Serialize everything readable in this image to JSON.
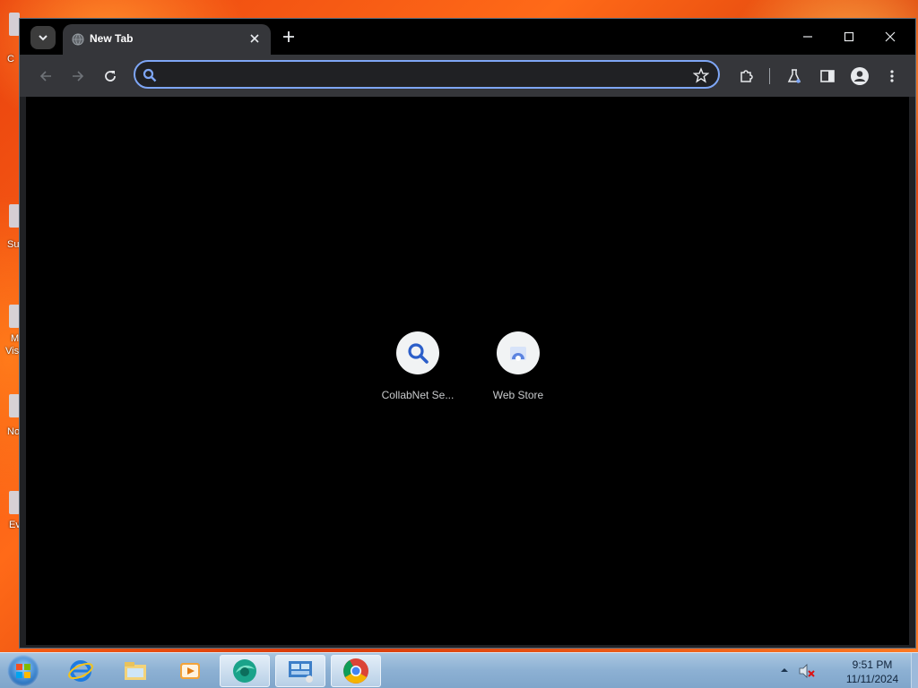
{
  "browser": {
    "tab": {
      "title": "New Tab"
    },
    "omnibox": {
      "value": "",
      "placeholder": ""
    },
    "shortcuts": [
      {
        "label": "CollabNet Se...",
        "icon": "search-icon"
      },
      {
        "label": "Web Store",
        "icon": "web-store-icon"
      }
    ],
    "colors": {
      "accent": "#7ea6f5",
      "toolbar": "#35363a",
      "page_background": "#000000"
    }
  },
  "taskbar": {
    "pinned": [
      "internet-explorer-icon",
      "file-explorer-icon",
      "media-player-icon",
      "browser-app-icon",
      "control-panel-icon",
      "chrome-icon"
    ],
    "clock": {
      "time": "9:51 PM",
      "date": "11/11/2024"
    }
  },
  "desktop": {
    "partial_labels": [
      "C",
      "Su",
      "M",
      "Vis",
      "No",
      "Ev"
    ]
  }
}
